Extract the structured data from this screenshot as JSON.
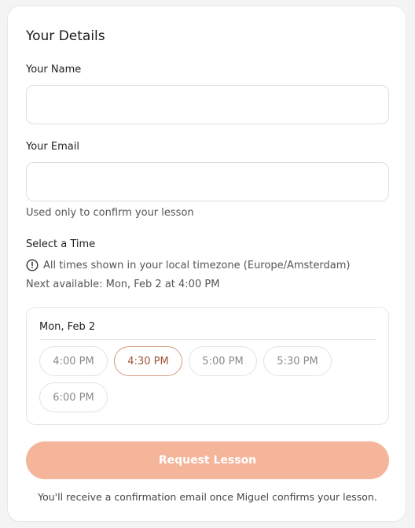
{
  "form": {
    "title": "Your Details",
    "name_label": "Your Name",
    "name_value": "",
    "email_label": "Your Email",
    "email_value": "",
    "email_hint": "Used only to confirm your lesson",
    "time_label": "Select a Time",
    "timezone_note": "All times shown in your local timezone (Europe/Amsterdam)",
    "next_available": "Next available: Mon, Feb 2 at 4:00 PM",
    "clock_icon": "clock-icon"
  },
  "schedule": {
    "day": "Mon, Feb 2",
    "slots": [
      "4:00 PM",
      "4:30 PM",
      "5:00 PM",
      "5:30 PM",
      "6:00 PM"
    ],
    "selected": "4:30 PM"
  },
  "submit": {
    "label": "Request Lesson",
    "color": "#f4b59a"
  },
  "footer": {
    "note": "You'll receive a confirmation email once Miguel confirms your lesson."
  },
  "colors": {
    "accent": "#f4b59a",
    "selected_border": "#d49a80",
    "selected_text": "#a0553a"
  }
}
